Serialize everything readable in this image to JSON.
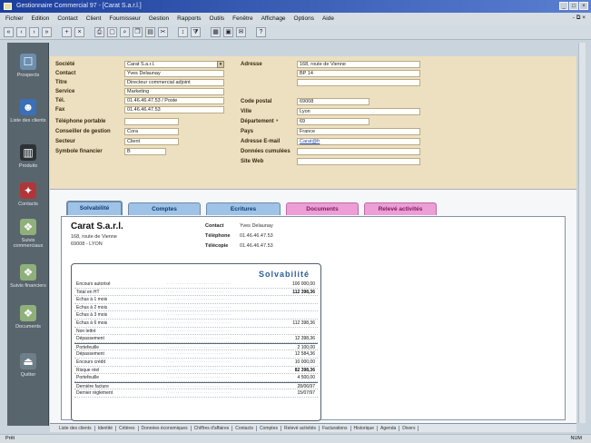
{
  "window": {
    "title": "Gestionnaire Commercial 97 - [Carat S.a.r.l.]"
  },
  "menubar": {
    "items": [
      "Fichier",
      "Edition",
      "Contact",
      "Client",
      "Fournisseur",
      "Gestion",
      "Rapports",
      "Outils",
      "Fenêtre",
      "Affichage",
      "Options",
      "Aide"
    ],
    "right": "- ⧉ ×"
  },
  "sidebar": {
    "items": [
      {
        "label": "Prospects",
        "icon": "prospects-icon"
      },
      {
        "label": "Liste des clients",
        "icon": "clients-icon"
      },
      {
        "label": "Produits",
        "icon": "products-icon"
      },
      {
        "label": "Contacts",
        "icon": "contacts-icon"
      },
      {
        "label": "Suivis commerciaux",
        "icon": "followups-icon"
      },
      {
        "label": "Suivis financiers",
        "icon": "finance-icon"
      },
      {
        "label": "Documents",
        "icon": "documents-icon"
      },
      {
        "label": "Quitter",
        "icon": "exit-icon"
      }
    ]
  },
  "header": {
    "left_labels": [
      "Société",
      "Contact",
      "Titre",
      "Service",
      "Tél.",
      "Fax",
      "Téléphone portable",
      "Conseiller de gestion",
      "Secteur",
      "Symbole financier"
    ],
    "left_values": [
      "Carat S.a.r.l.",
      "Yves Delaunay",
      "Directeur commercial adjoint",
      "Marketing",
      "01.46.46.47.53 / Poste",
      "01.46.46.47.53",
      "",
      "Cora",
      "Client",
      "B"
    ],
    "right_labels": [
      "Adresse",
      "",
      "Code postal",
      "Ville",
      "Département",
      "Pays",
      "Adresse E-mail",
      "Données cumulées",
      "Site Web"
    ],
    "right_values": [
      "168, route de Vienne",
      "BP 14",
      "69008",
      "Lyon",
      "69",
      "France",
      "Carat@fr",
      "",
      ""
    ]
  },
  "tabs": [
    {
      "label": "Solvabilité",
      "style": "active"
    },
    {
      "label": "Comptes",
      "style": "blue"
    },
    {
      "label": "Ecritures",
      "style": "blue"
    },
    {
      "label": "Documents",
      "style": "pink"
    },
    {
      "label": "Relevé activités",
      "style": "pink"
    }
  ],
  "summary": {
    "company": "Carat S.a.r.l.",
    "address_line1": "168, route de Vienne",
    "address_line2": "69008 - LYON",
    "contact_label": "Contact",
    "contact_value": "Yves Delaunay",
    "phone_label": "Téléphone",
    "phone_value": "01.46.46.47.53",
    "fax_label": "Télécopie",
    "fax_value": "01.46.46.47.53"
  },
  "solvabilite": {
    "title": "Solvabilité",
    "rows": [
      {
        "label": "Encours autorisé",
        "value": "100 000,00",
        "bold": false,
        "sep": false
      },
      {
        "label": "Total en HT",
        "value": "112 398,36",
        "bold": true,
        "sep": false
      },
      {
        "label": "Echus à 1 mois",
        "value": "",
        "bold": false,
        "sep": false
      },
      {
        "label": "Echus à 2 mois",
        "value": "",
        "bold": false,
        "sep": false
      },
      {
        "label": "Echus à 3 mois",
        "value": "",
        "bold": false,
        "sep": false
      },
      {
        "label": "Echus à 6 mois",
        "value": "112 398,36",
        "bold": false,
        "sep": false
      },
      {
        "label": "Non lettré",
        "value": "",
        "bold": false,
        "sep": false
      },
      {
        "label": "Dépassement",
        "value": "12 398,36",
        "bold": false,
        "sep": false
      },
      {
        "label": "Portefeuille",
        "value": "2 100,00",
        "bold": false,
        "sep": true
      },
      {
        "label": "Dépassement",
        "value": "12 584,36",
        "bold": false,
        "sep": false
      },
      {
        "label": "Encours crédit",
        "value": "10 000,00",
        "bold": false,
        "sep": false
      },
      {
        "label": "Risque réel",
        "value": "82 398,36",
        "bold": true,
        "sep": false
      },
      {
        "label": "Portefeuille",
        "value": "4 500,00",
        "bold": false,
        "sep": false
      },
      {
        "label": "Dernière facture",
        "value": "28/06/97",
        "bold": false,
        "sep": true
      },
      {
        "label": "Dernier règlement",
        "value": "15/07/97",
        "bold": false,
        "sep": false
      }
    ]
  },
  "bottom_tabs": [
    "Liste des clients",
    "Identité",
    "Critères",
    "Données économiques",
    "Chiffres d'affaires",
    "Contacts",
    "Comptes",
    "Relevé activités",
    "Facturations",
    "Historique",
    "Agenda",
    "Divers"
  ],
  "statusbar": {
    "left": "Prêt",
    "right": "NUM"
  }
}
